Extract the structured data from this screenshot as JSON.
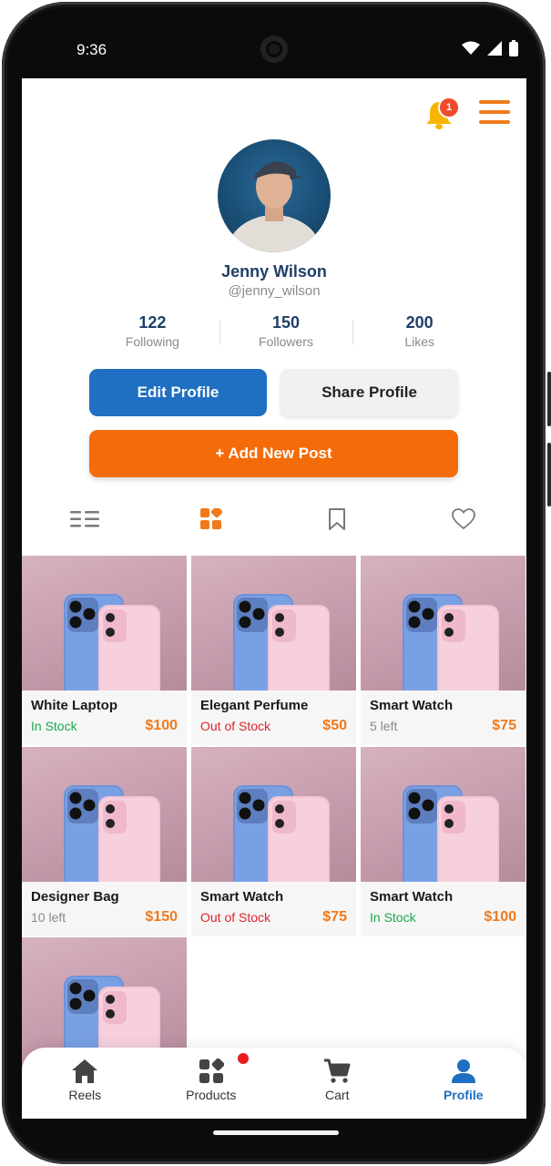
{
  "status_bar": {
    "time": "9:36"
  },
  "header": {
    "notification_count": "1"
  },
  "profile": {
    "name": "Jenny Wilson",
    "handle": "@jenny_wilson",
    "stats": [
      {
        "value": "122",
        "label": "Following"
      },
      {
        "value": "150",
        "label": "Followers"
      },
      {
        "value": "200",
        "label": "Likes"
      }
    ]
  },
  "actions": {
    "edit_label": "Edit Profile",
    "share_label": "Share Profile",
    "add_post_label": "+ Add New Post"
  },
  "view_tabs": [
    {
      "icon": "list-icon",
      "active": false
    },
    {
      "icon": "grid-icon",
      "active": true
    },
    {
      "icon": "bookmark-icon",
      "active": false
    },
    {
      "icon": "heart-icon",
      "active": false
    }
  ],
  "products": [
    {
      "title": "White Laptop",
      "status": "In Stock",
      "status_type": "in",
      "price": "$100"
    },
    {
      "title": "Elegant Perfume",
      "status": "Out of Stock",
      "status_type": "out",
      "price": "$50"
    },
    {
      "title": "Smart Watch",
      "status": "5 left",
      "status_type": "low",
      "price": "$75"
    },
    {
      "title": "Designer Bag",
      "status": "10 left",
      "status_type": "low",
      "price": "$150"
    },
    {
      "title": "Smart Watch",
      "status": "Out of Stock",
      "status_type": "out",
      "price": "$75"
    },
    {
      "title": "Smart Watch",
      "status": "In Stock",
      "status_type": "in",
      "price": "$100"
    },
    {
      "title": "",
      "status": "",
      "status_type": "",
      "price": ""
    }
  ],
  "bottom_nav": [
    {
      "label": "Reels",
      "icon": "home-icon",
      "active": false
    },
    {
      "label": "Products",
      "icon": "products-icon",
      "active": false,
      "has_dot": true
    },
    {
      "label": "Cart",
      "icon": "cart-icon",
      "active": false
    },
    {
      "label": "Profile",
      "icon": "user-icon",
      "active": true
    }
  ],
  "colors": {
    "primary_blue": "#1f6fc2",
    "accent_orange": "#f46c0a",
    "in_stock": "#1aa84c",
    "out_of_stock": "#e0232e",
    "low_stock": "#8a8a8a"
  }
}
